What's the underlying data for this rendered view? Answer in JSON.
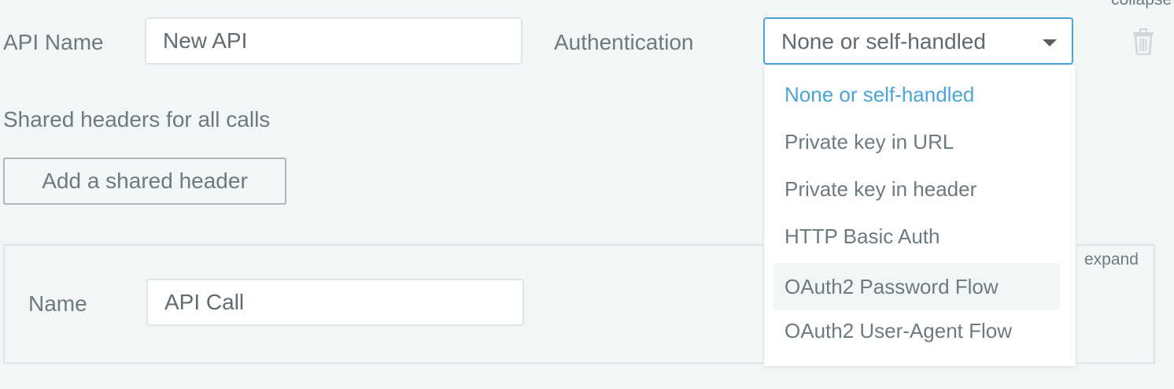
{
  "api": {
    "name_label": "API Name",
    "name_value": "New API",
    "auth_label": "Authentication",
    "auth_selected": "None or self-handled",
    "collapse_label": "collapse"
  },
  "auth_options": [
    "None or self-handled",
    "Private key in URL",
    "Private key in header",
    "HTTP Basic Auth",
    "OAuth2 Password Flow",
    "OAuth2 User-Agent Flow"
  ],
  "shared_headers": {
    "label": "Shared headers for all calls",
    "add_button": "Add a shared header"
  },
  "call": {
    "name_label": "Name",
    "name_value": "API Call",
    "expand_label": "expand"
  },
  "colors": {
    "accent": "#4aa5d6",
    "text": "#6d7a80",
    "background": "#f3f6f7"
  },
  "icons": {
    "delete": "trash-icon",
    "dropdown": "caret-down-icon"
  }
}
